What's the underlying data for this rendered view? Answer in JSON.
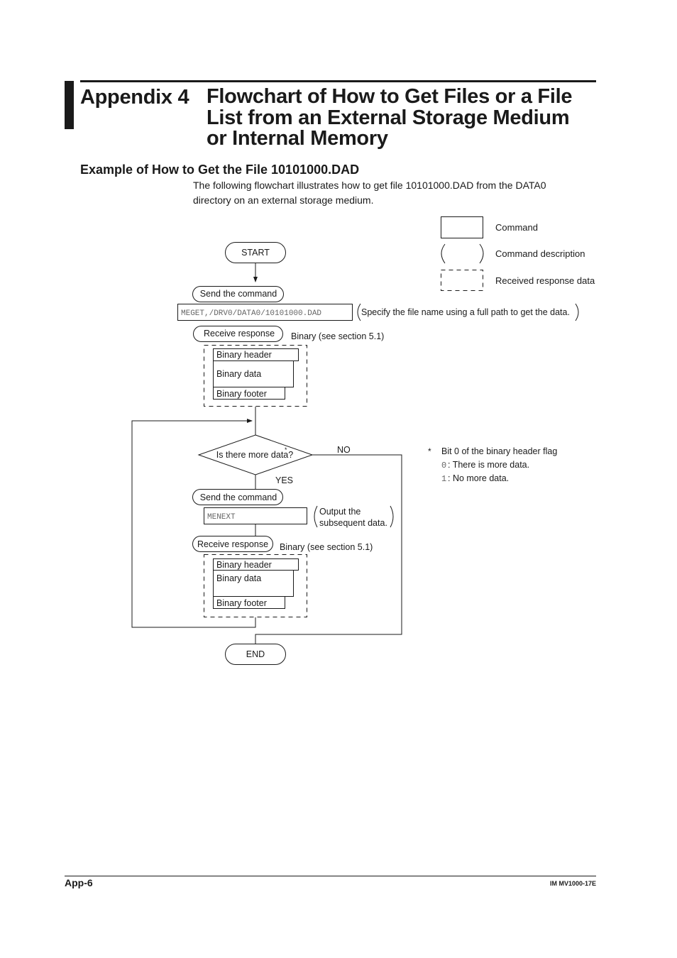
{
  "header": {
    "appendix_label": "Appendix 4",
    "title_lines": [
      "Flowchart of How to Get Files or a File",
      "List from an External Storage Medium",
      "or Internal Memory"
    ]
  },
  "section": {
    "heading": "Example of How to Get the File 10101000.DAD",
    "intro_lines": [
      "The following flowchart illustrates how to get file 10101000.DAD from the DATA0",
      "directory on an external storage medium."
    ]
  },
  "legend": {
    "command": "Command",
    "command_description": "Command description",
    "received_response": "Received response data"
  },
  "flowchart": {
    "start": "START",
    "send_command_1": "Send the command",
    "command_1": "MEGET,/DRV0/DATA0/10101000.DAD",
    "command_1_description": "Specify the file name using a full path to get the data.",
    "receive_response_1": "Receive response",
    "response_1_note": "Binary (see section 5.1)",
    "response_1_blocks": [
      "Binary header",
      "Binary data",
      "Binary footer"
    ],
    "decision": "Is there more data?",
    "decision_marker": "*",
    "no_label": "NO",
    "yes_label": "YES",
    "send_command_2": "Send the command",
    "command_2": "MENEXT",
    "command_2_description": [
      "Output the",
      "subsequent data."
    ],
    "receive_response_2": "Receive response",
    "response_2_note": "Binary (see section 5.1)",
    "response_2_blocks": [
      "Binary header",
      "Binary data",
      "Binary footer"
    ],
    "end": "END"
  },
  "footnote": {
    "marker": "*",
    "title": "Bit 0 of the binary header flag",
    "items": [
      {
        "code": "0",
        "text": ": There is more data."
      },
      {
        "code": "1",
        "text": ": No more data."
      }
    ]
  },
  "footer": {
    "page_number": "App-6",
    "document_id": "IM MV1000-17E"
  }
}
